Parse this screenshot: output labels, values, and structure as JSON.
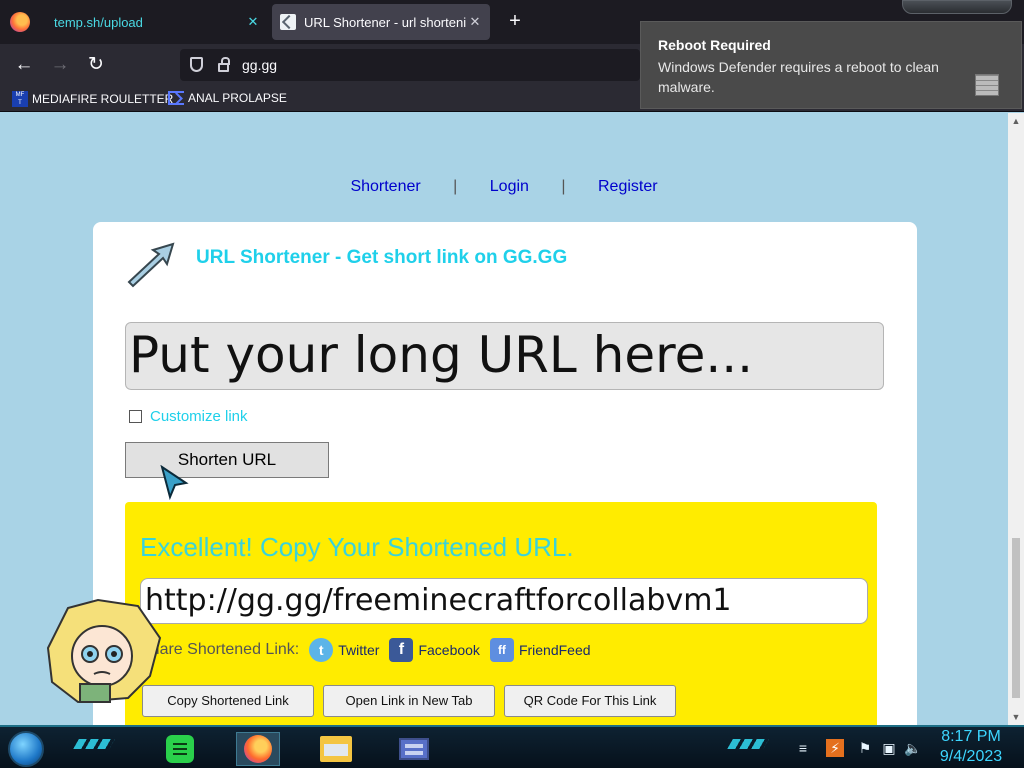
{
  "browser": {
    "tabs": [
      {
        "title": "temp.sh/upload",
        "close": "✕"
      },
      {
        "title": "URL Shortener - url shortening",
        "close": "✕"
      }
    ],
    "new_tab": "+",
    "address": "gg.gg",
    "bookmarks": [
      {
        "label": "MEDIAFIRE ROULETTER",
        "icon": "mediafire-icon"
      },
      {
        "label": "ANAL PROLAPSE",
        "icon": "sigma-icon"
      }
    ]
  },
  "notification": {
    "title": "Reboot Required",
    "body": "Windows Defender requires a reboot to clean malware."
  },
  "page": {
    "nav": [
      "Shortener",
      "Login",
      "Register"
    ],
    "nav_sep": "|",
    "heading": "URL Shortener - Get short link on GG.GG",
    "url_input_value": "Put your long URL here...",
    "customize_label": "Customize link",
    "shorten_button": "Shorten URL",
    "result": {
      "heading": "Excellent! Copy Your Shortened URL.",
      "short_url": "http://gg.gg/freeminecraftforcollabvm1",
      "share_label": "Share Shortened Link:",
      "share": [
        {
          "label": "Twitter",
          "icon": "t"
        },
        {
          "label": "Facebook",
          "icon": "f"
        },
        {
          "label": "FriendFeed",
          "icon": "ff"
        }
      ],
      "buttons": [
        "Copy Shortened Link",
        "Open Link in New Tab",
        "QR Code For This Link"
      ]
    },
    "accent_color": "#1fd0ea",
    "result_bg": "#ffec00"
  },
  "taskbar": {
    "time": "8:17 PM",
    "date": "9/4/2023"
  }
}
